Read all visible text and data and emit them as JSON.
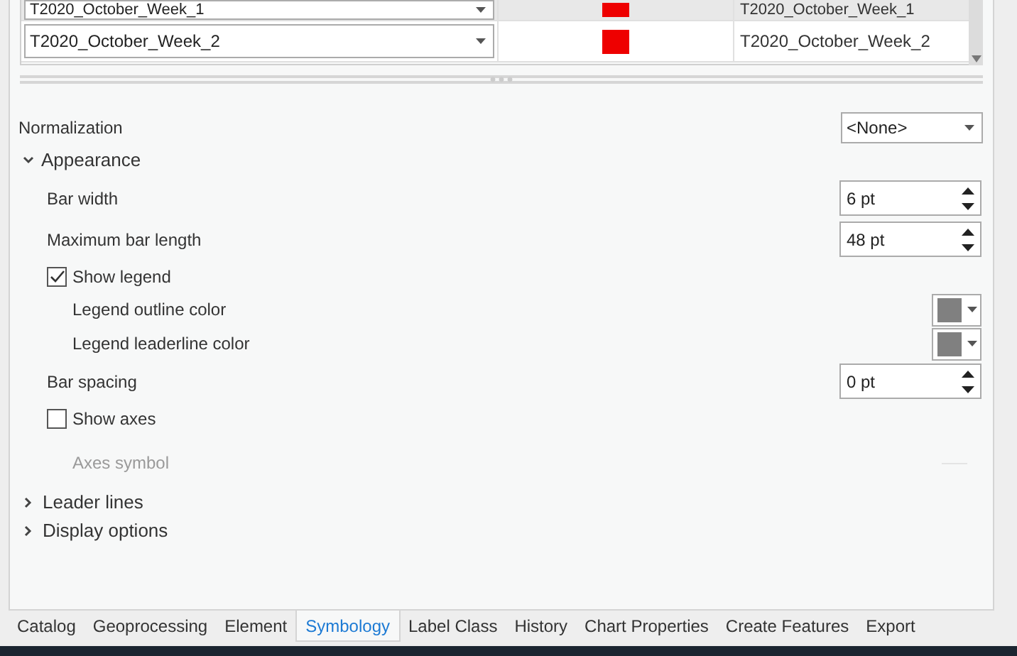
{
  "table": {
    "rows": [
      {
        "field": "T2020_October_Week_1",
        "color": "#ee0000",
        "label": "T2020_October_Week_1",
        "selected": true
      },
      {
        "field": "T2020_October_Week_2",
        "color": "#ee0000",
        "label": "T2020_October_Week_2",
        "selected": false
      }
    ]
  },
  "normalization": {
    "label": "Normalization",
    "value": "<None>"
  },
  "appearance": {
    "title": "Appearance",
    "expanded": true,
    "items": [
      {
        "kind": "spinner",
        "label": "Bar width",
        "value": "6 pt"
      },
      {
        "kind": "spinner",
        "label": "Maximum bar length",
        "value": "48 pt"
      },
      {
        "kind": "checkbox",
        "label": "Show legend",
        "checked": true,
        "children": [
          {
            "kind": "color",
            "label": "Legend outline color",
            "color": "#808080"
          },
          {
            "kind": "color",
            "label": "Legend leaderline color",
            "color": "#808080"
          }
        ]
      },
      {
        "kind": "spinner",
        "label": "Bar spacing",
        "value": "0 pt"
      },
      {
        "kind": "checkbox",
        "label": "Show axes",
        "checked": false,
        "children": [
          {
            "kind": "symbol",
            "label": "Axes symbol",
            "disabled": true
          }
        ]
      }
    ]
  },
  "sections": [
    {
      "title": "Leader lines",
      "expanded": false
    },
    {
      "title": "Display options",
      "expanded": false
    }
  ],
  "tabs": [
    {
      "label": "Catalog",
      "selected": false
    },
    {
      "label": "Geoprocessing",
      "selected": false
    },
    {
      "label": "Element",
      "selected": false
    },
    {
      "label": "Symbology",
      "selected": true
    },
    {
      "label": "Label Class",
      "selected": false
    },
    {
      "label": "History",
      "selected": false
    },
    {
      "label": "Chart Properties",
      "selected": false
    },
    {
      "label": "Create Features",
      "selected": false
    },
    {
      "label": "Export",
      "selected": false
    }
  ]
}
